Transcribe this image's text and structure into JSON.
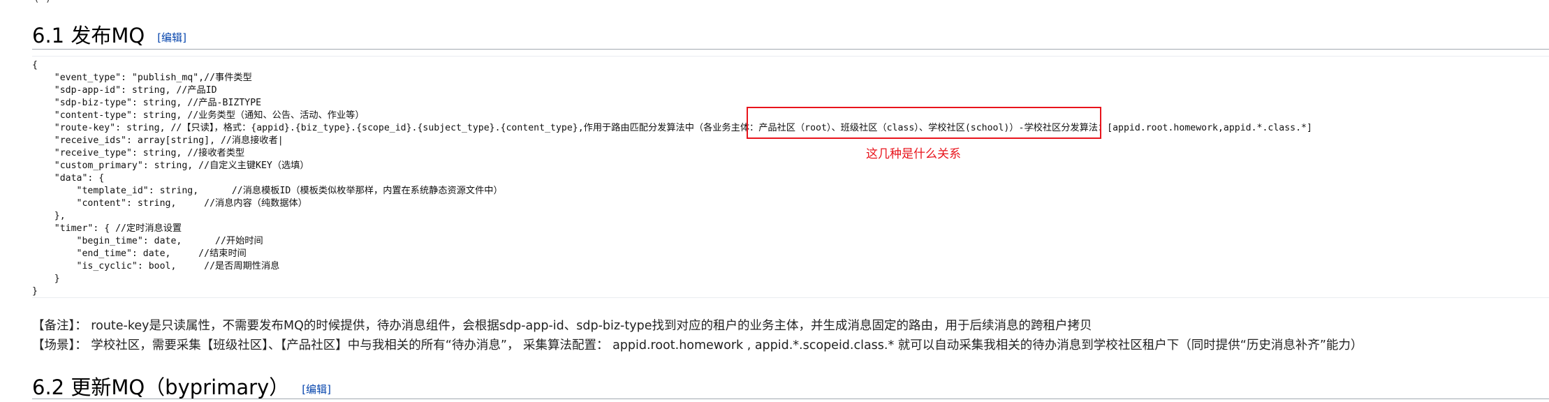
{
  "top_clip_text": "        (                        )",
  "section_61": {
    "title": "6.1 发布MQ",
    "edit_label": "编辑"
  },
  "code_lines": [
    "{",
    "    \"event_type\": \"publish_mq\",//事件类型",
    "    \"sdp-app-id\": string, //产品ID",
    "    \"sdp-biz-type\": string, //产品-BIZTYPE",
    "    \"content-type\": string, //业务类型（通知、公告、活动、作业等）",
    "    \"route-key\": string, //【只读】，格式：{appid}.{biz_type}.{scope_id}.{subject_type}.{content_type},作用于路由匹配分发算法中（各业务主体：产品社区（root）、班级社区（class）、学校社区(school)）-学校社区分发算法：[appid.root.homework,appid.*.class.*]",
    "    \"receive_ids\": array[string], //消息接收者|",
    "    \"receive_type\": string, //接收者类型",
    "    \"custom_primary\": string, //自定义主键KEY（选填）",
    "    \"data\": {",
    "        \"template_id\": string,      //消息模板ID（模板类似枚举那样，内置在系统静态资源文件中）",
    "        \"content\": string,     //消息内容（纯数据体）",
    "    },",
    "    \"timer\": { //定时消息设置",
    "        \"begin_time\": date,      //开始时间",
    "        \"end_time\": date,     //结束时间",
    "        \"is_cyclic\": bool,     //是否周期性消息",
    "    }",
    "}"
  ],
  "annotation": {
    "text": "这几种是什么关系",
    "color": "#e8141c"
  },
  "notes": {
    "remark": "【备注】：  route-key是只读属性，不需要发布MQ的时候提供，待办消息组件，会根据sdp-app-id、sdp-biz-type找到对应的租户的业务主体，并生成消息固定的路由，用于后续消息的跨租户拷贝",
    "scenario": "【场景】：  学校社区，需要采集【班级社区】、【产品社区】中与我相关的所有“待办消息”，  采集算法配置：  appid.root.homework , appid.*.scopeid.class.* 就可以自动采集我相关的待办消息到学校社区租户下（同时提供“历史消息补齐”能力）"
  },
  "section_62": {
    "title": "6.2 更新MQ（byprimary）",
    "edit_label": "编辑"
  }
}
